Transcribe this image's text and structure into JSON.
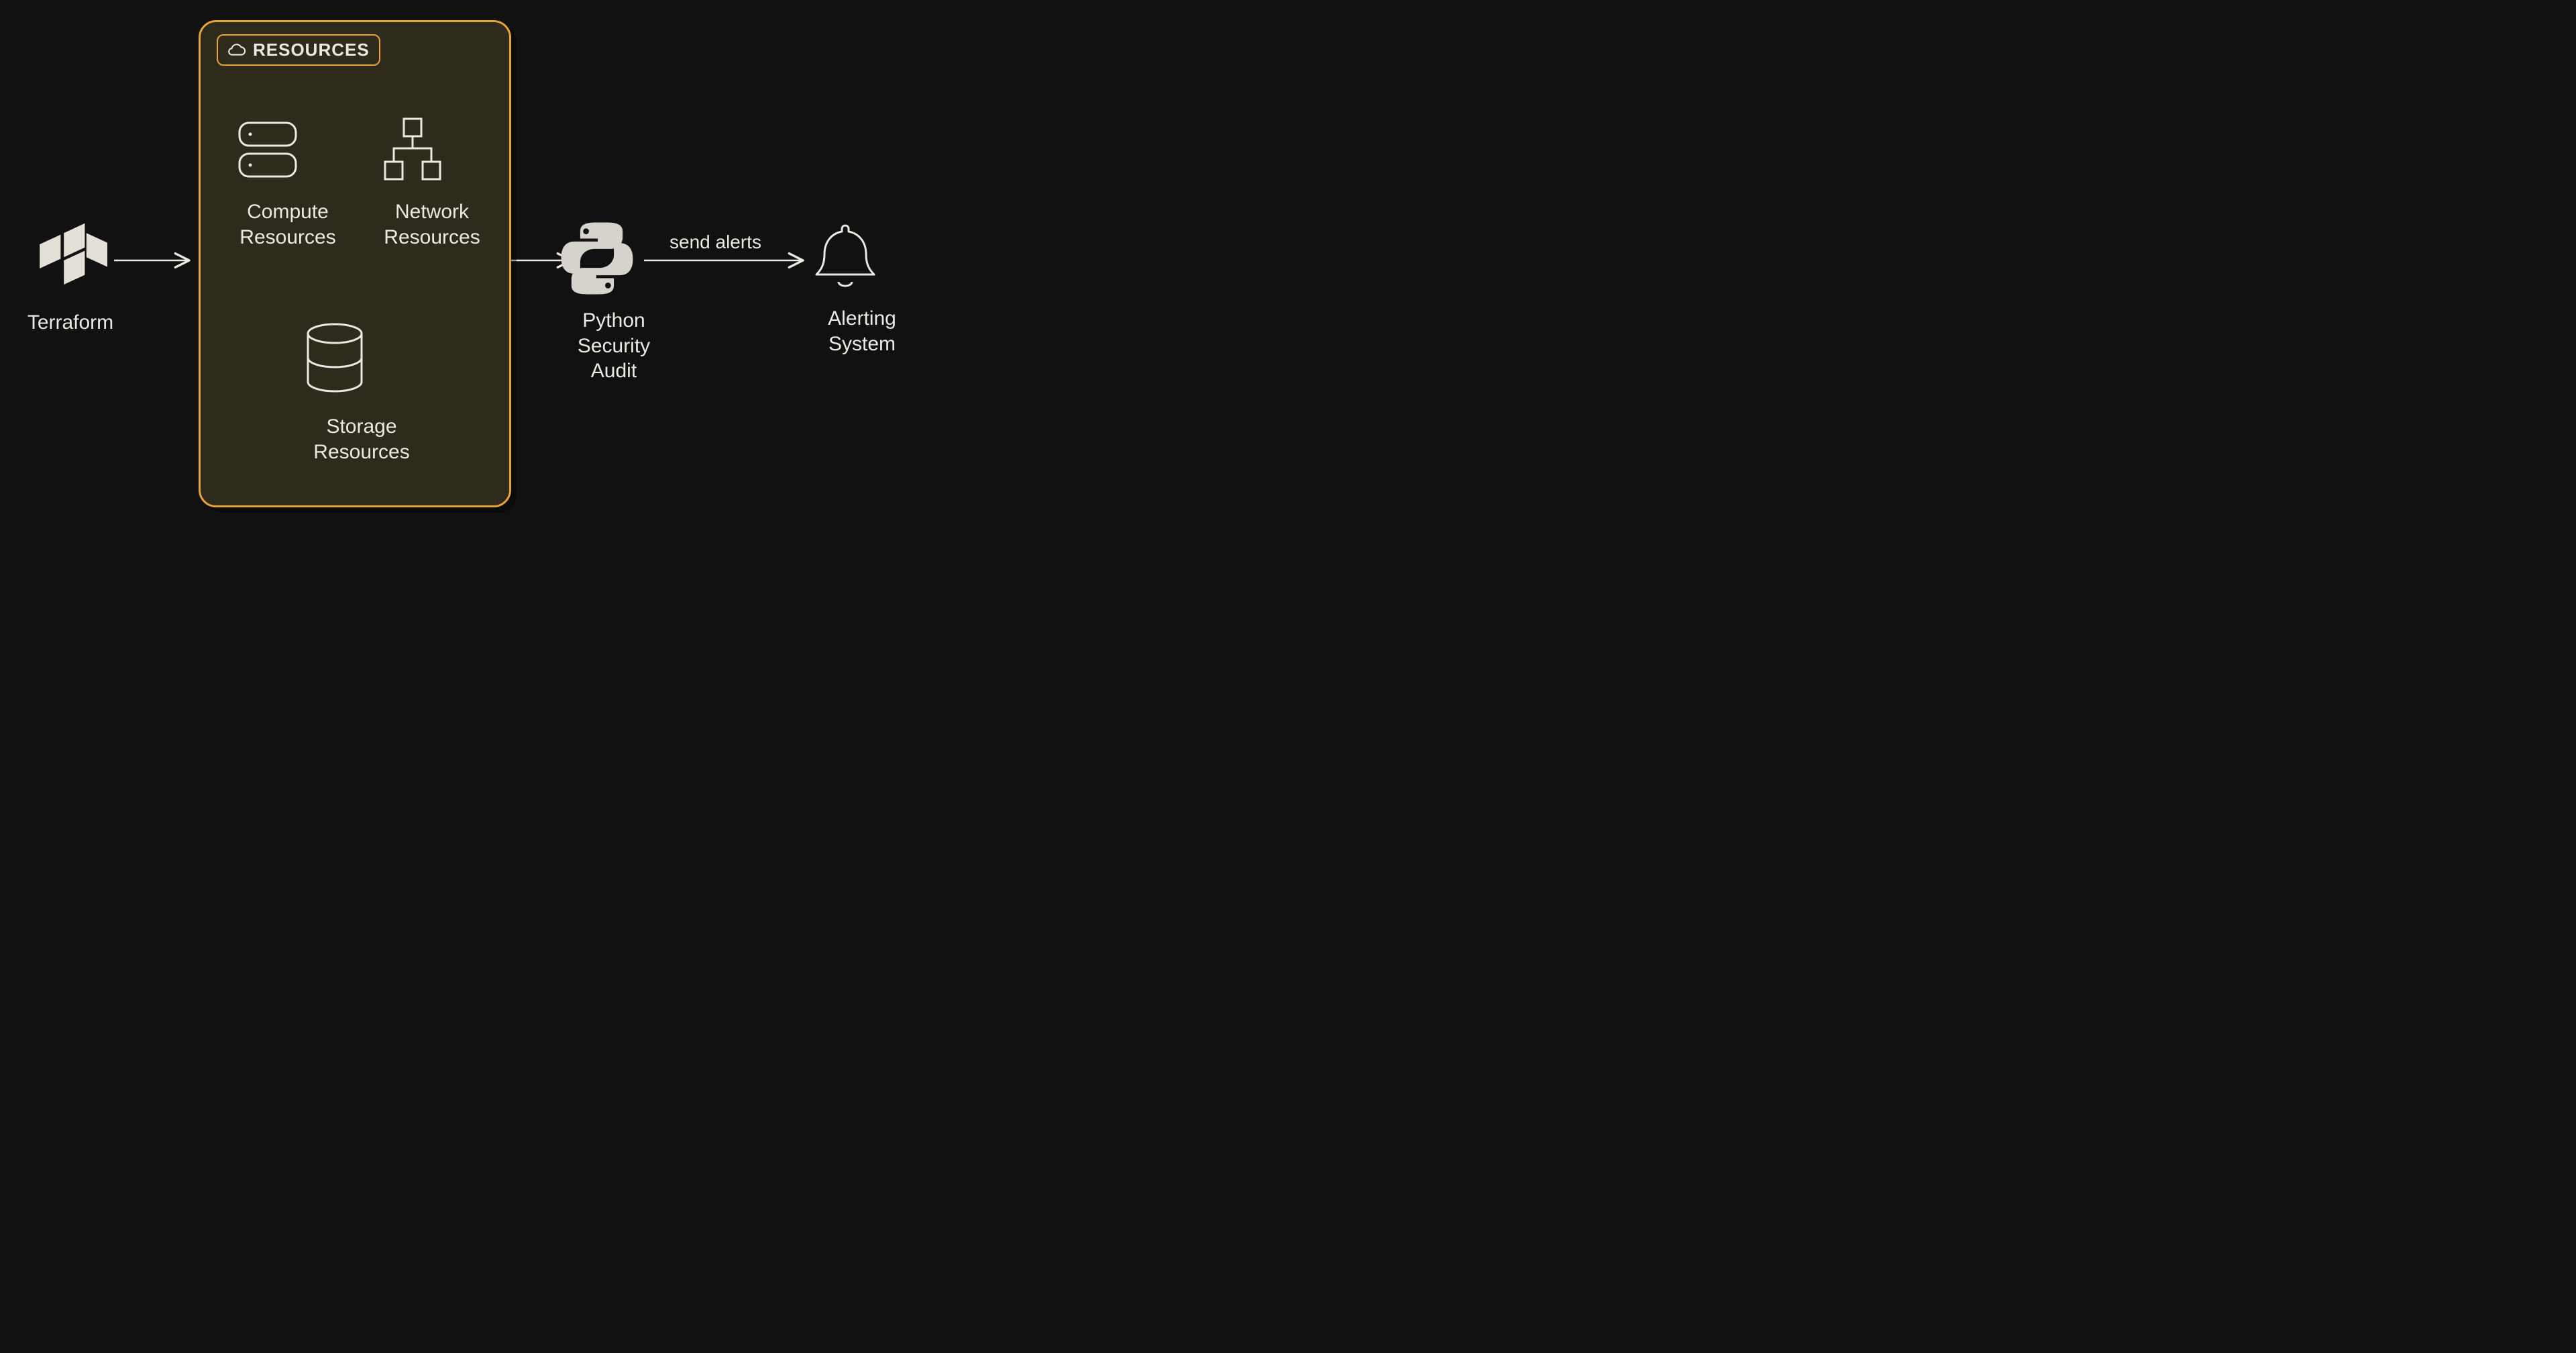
{
  "terraform": {
    "label": "Terraform"
  },
  "resources_panel": {
    "title": "RESOURCES",
    "compute": {
      "label_1": "Compute",
      "label_2": "Resources"
    },
    "network": {
      "label_1": "Network",
      "label_2": "Resources"
    },
    "storage": {
      "label_1": "Storage",
      "label_2": "Resources"
    }
  },
  "python_audit": {
    "label_1": "Python",
    "label_2": "Security",
    "label_3": "Audit"
  },
  "alerting": {
    "label_1": "Alerting",
    "label_2": "System"
  },
  "edges": {
    "send_alerts": "send alerts"
  }
}
